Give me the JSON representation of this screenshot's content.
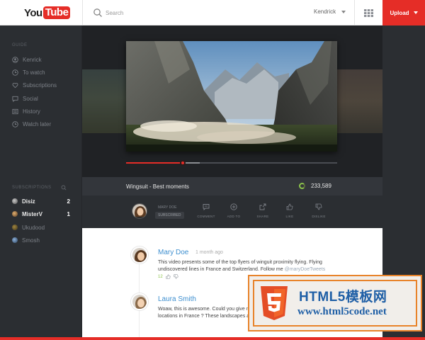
{
  "topbar": {
    "logo_you": "You",
    "logo_tube": "Tube",
    "search_placeholder": "Search",
    "user_name": "Kendrick",
    "upload_label": "Upload"
  },
  "sidebar": {
    "guide_title": "GUIDE",
    "guide_items": [
      {
        "label": "Kenrick",
        "icon": "user-icon"
      },
      {
        "label": "To watch",
        "icon": "clock-icon"
      },
      {
        "label": "Subscriptions",
        "icon": "heart-icon"
      },
      {
        "label": "Social",
        "icon": "chat-icon"
      },
      {
        "label": "History",
        "icon": "history-icon"
      },
      {
        "label": "Watch later",
        "icon": "clock-icon"
      }
    ],
    "subs_title": "SUBSCRIPTIONS",
    "subscriptions": [
      {
        "name": "Disiz",
        "count": "2",
        "unread": true
      },
      {
        "name": "MisterV",
        "count": "1",
        "unread": true
      },
      {
        "name": "Ukudood",
        "count": "",
        "unread": false
      },
      {
        "name": "Smosh",
        "count": "",
        "unread": false
      }
    ]
  },
  "video": {
    "title": "Wingsuit - Best moments",
    "views": "233,589",
    "progress_played": 0.27,
    "progress_buffered": 0.35
  },
  "channel": {
    "name": "MARY DOE",
    "subscribed_label": "SUBSCRIBED"
  },
  "actions": [
    {
      "label": "COMMENT",
      "icon": "comment-icon"
    },
    {
      "label": "ADD TO",
      "icon": "add-icon"
    },
    {
      "label": "SHARE",
      "icon": "share-icon"
    },
    {
      "label": "LIKE",
      "icon": "thumbs-up-icon"
    },
    {
      "label": "DISLIKE",
      "icon": "thumbs-down-icon"
    }
  ],
  "comments": [
    {
      "author": "Mary Doe",
      "time": "1 month ago",
      "text_line1": "This video presents some of the top flyers of winguit proximity flying. Flying",
      "text_line2": "undiscovered lines in France and Switzerland. Follow me",
      "mention": "@maryDoeTweets",
      "likes": "12"
    },
    {
      "author": "Laura Smith",
      "time": "",
      "text_line1": "Woaw, this is awesome. Could you give me",
      "text_line2": "locations in France ? These landscapes are",
      "mention": "",
      "likes": ""
    }
  ],
  "watermark": {
    "big_text": "HTML5模板网",
    "small_text": "www.html5code.net"
  },
  "colors": {
    "accent": "#e52d27",
    "sidebar_bg": "#2b2e32",
    "link_blue": "#3e8fcf",
    "green": "#8bc34a"
  }
}
